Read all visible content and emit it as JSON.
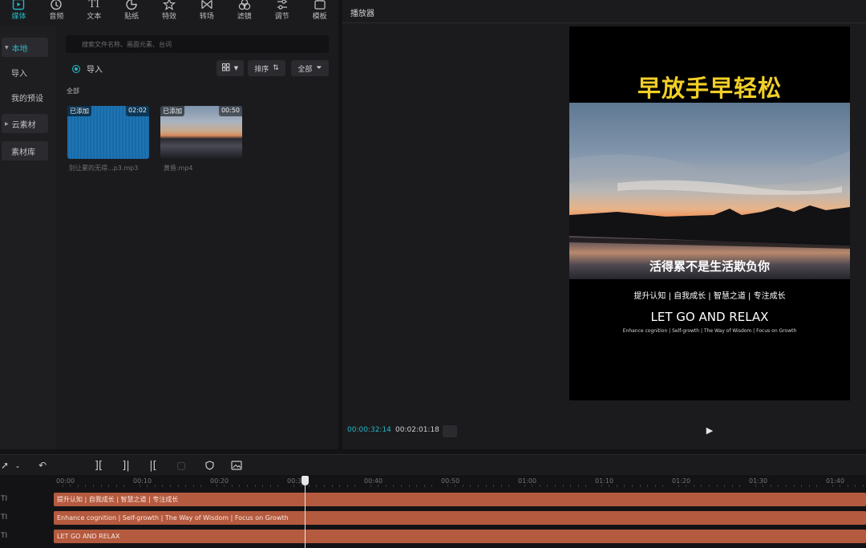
{
  "toolbar": {
    "items": [
      {
        "label": "媒体",
        "icon": "media-icon",
        "active": true
      },
      {
        "label": "音频",
        "icon": "audio-icon"
      },
      {
        "label": "文本",
        "icon": "text-icon"
      },
      {
        "label": "贴纸",
        "icon": "sticker-icon"
      },
      {
        "label": "特效",
        "icon": "effects-icon"
      },
      {
        "label": "转场",
        "icon": "transition-icon"
      },
      {
        "label": "滤镜",
        "icon": "filter-icon"
      },
      {
        "label": "调节",
        "icon": "adjust-icon"
      },
      {
        "label": "模板",
        "icon": "template-icon"
      }
    ]
  },
  "side_nav": {
    "local": "本地",
    "import": "导入",
    "presets": "我的预设",
    "cloud": "云素材",
    "library": "素材库"
  },
  "media": {
    "search_placeholder": "搜索文件名称、画面元素、台词",
    "import_label": "导入",
    "sort_label": "排序",
    "filter_label": "全部",
    "section_label": "全部",
    "items": [
      {
        "tag": "已添加",
        "duration": "02:02",
        "name": "別让累的无得...p3.mp3"
      },
      {
        "tag": "已添加",
        "duration": "00:50",
        "name": "黄昏.mp4"
      }
    ]
  },
  "player": {
    "title": "播放器",
    "video_title": "早放手早轻松",
    "caption": "活得累不是生活欺负你",
    "tags": "提升认知 | 自我成长 | 智慧之道 | 专注成长",
    "english_title": "LET GO AND RELAX",
    "english_sub": "Enhance cognition | Self-growth | The Way of Wisdom | Focus on Growth",
    "time_current": "00:00:32:14",
    "time_total": "00:02:01:18",
    "play_icon": "▶"
  },
  "timeline": {
    "ticks": [
      "00:00",
      "00:10",
      "00:20",
      "00:30",
      "00:40",
      "00:50",
      "01:00",
      "01:10",
      "01:20",
      "01:30",
      "01:40"
    ],
    "playhead_position_seconds": 32.5,
    "tracks": [
      {
        "icon": "TI",
        "clip": "提升认知 | 自我成长 | 智慧之道 | 专注成长"
      },
      {
        "icon": "TI",
        "clip": "Enhance cognition | Self-growth | The Way of Wisdom | Focus on Growth"
      },
      {
        "icon": "TI",
        "clip": "LET GO AND RELAX"
      }
    ]
  },
  "colors": {
    "accent": "#27b6c4",
    "title_yellow": "#f2cf27",
    "clip": "#b45a3f",
    "panel": "#1b1b1e"
  }
}
